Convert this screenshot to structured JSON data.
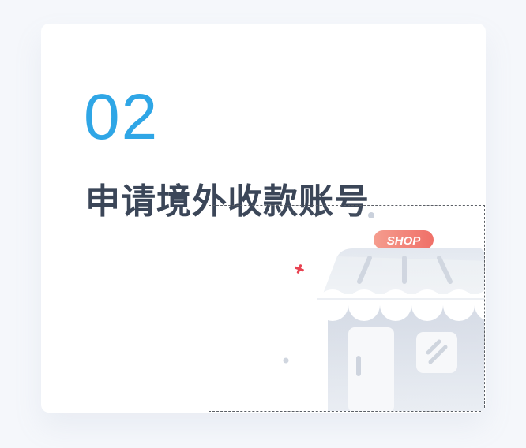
{
  "step": {
    "number": "02",
    "title": "申请境外收款账号"
  },
  "illustration": {
    "icon": "shop-storefront-icon",
    "sign_text": "SHOP"
  },
  "colors": {
    "accent": "#2fa6e6",
    "title": "#3b4658",
    "background": "#f5f7fb",
    "card": "#ffffff",
    "sign": "#f2736b",
    "sparkle": "#e8404f"
  }
}
